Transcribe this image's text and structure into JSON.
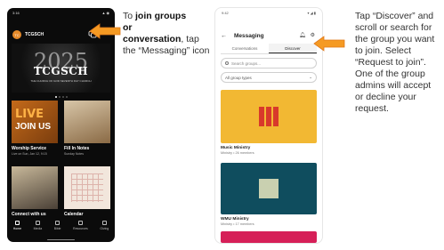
{
  "phone1": {
    "status_time": "3:16",
    "status_icons": "▲ ◉",
    "app_name": "TCGSCH",
    "logo_text": "TC",
    "hero": {
      "year": "2025",
      "title": "TCGSCH",
      "subtitle": "THE CHURCH OF GOD SEVENTH DAY CHURCH"
    },
    "tiles": [
      {
        "caption": "Worship Service",
        "sub": "Live on Sun, Jan 12, 9:15"
      },
      {
        "caption": "Fill In Notes",
        "sub": "Sunday Notes"
      },
      {
        "caption": "Connect with us",
        "sub": ""
      },
      {
        "caption": "Calendar",
        "sub": ""
      }
    ],
    "tile_art": {
      "live": "LIVE",
      "join": "JOIN US"
    },
    "nav": [
      "Home",
      "Media",
      "Bible",
      "Resources",
      "Giving"
    ]
  },
  "instruction1": {
    "pre": "To ",
    "bold1": "join groups",
    "bold2": "or",
    "bold3": "conversation",
    "post": ", tap the “Messaging” icon"
  },
  "phone2": {
    "status_time": "9:42",
    "status_icons": "▾ ◢ ▮",
    "title": "Messaging",
    "tabs": [
      "Conversations",
      "Discover"
    ],
    "active_tab": "Discover",
    "search_placeholder": "Search groups...",
    "filter_label": "All group types",
    "groups": [
      {
        "name": "Music Ministry",
        "meta": "Ministry • 26 members",
        "color": "#f2b833"
      },
      {
        "name": "WMU Ministry",
        "meta": "Ministry • 17 members",
        "color": "#0f4d5e"
      },
      {
        "name": "",
        "meta": "",
        "color": "#d61f58"
      }
    ]
  },
  "instruction2": "Tap “Discover” and scroll or search for the group you want to join. Select “Request to join”. One of the group admins will accept or decline your request.",
  "colors": {
    "arrow_orange": "#f59a23",
    "arrow_outline": "#e0781a"
  }
}
